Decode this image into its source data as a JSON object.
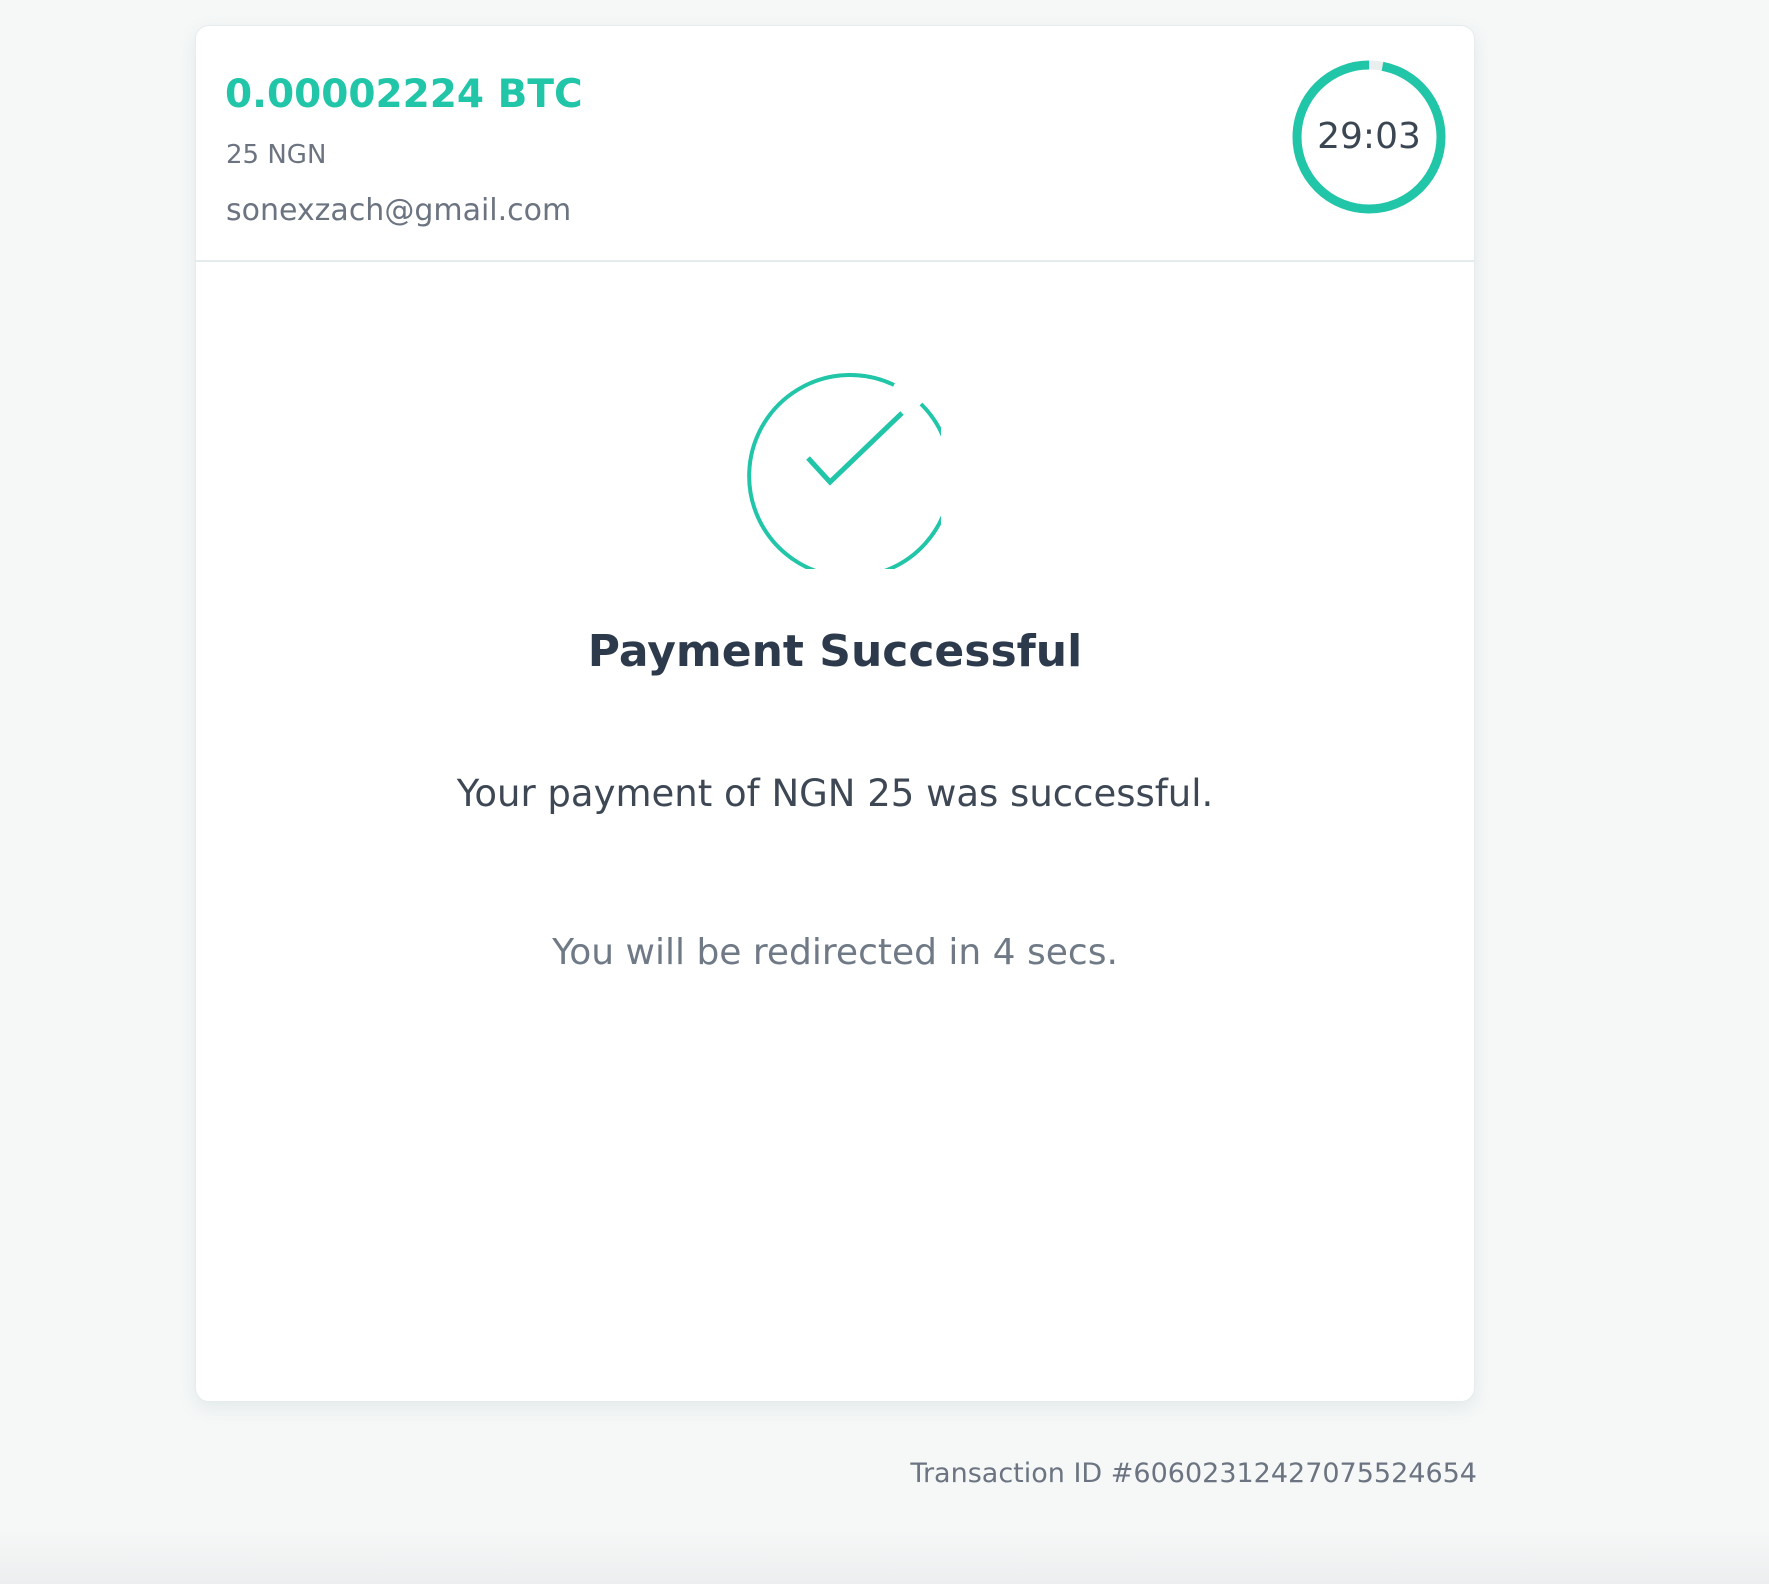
{
  "payment": {
    "amount_crypto": "0.00002224 BTC",
    "amount_fiat": "25 NGN",
    "email": "sonexzach@gmail.com",
    "timer": {
      "text": "29:03",
      "remaining_fraction": 0.97,
      "ring_color": "#21c5a8",
      "track_color": "#e9eeef"
    }
  },
  "status": {
    "icon": "check-circle-icon",
    "accent_color": "#21c5a8",
    "title": "Payment Successful",
    "message": "Your payment of NGN 25 was successful.",
    "redirect": "You will be redirected in 4 secs."
  },
  "footer": {
    "transaction_id": "Transaction ID #6060231242707552465​4"
  }
}
